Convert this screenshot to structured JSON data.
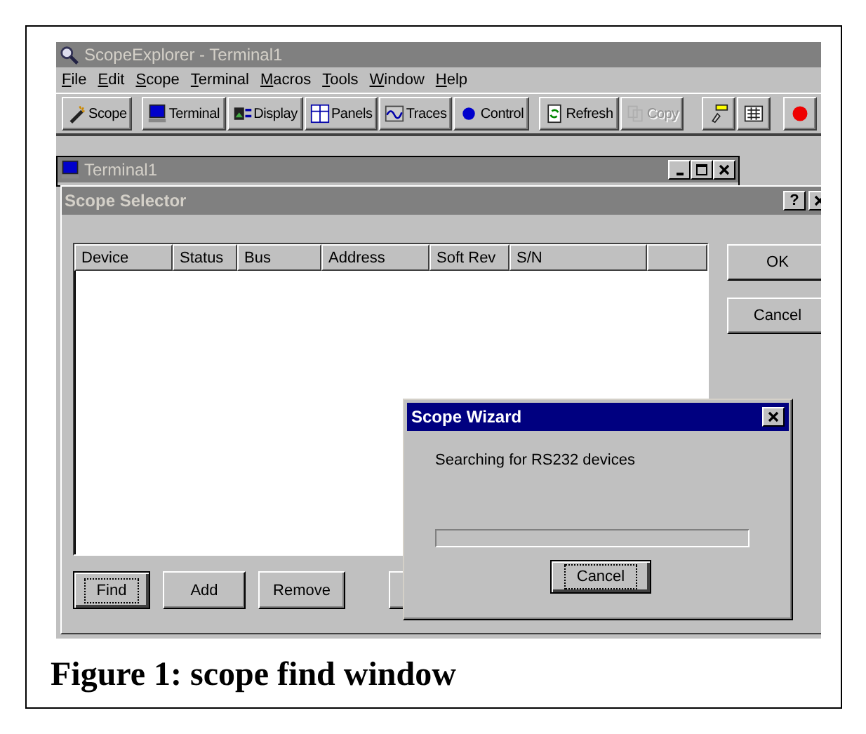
{
  "window": {
    "title": "ScopeExplorer - Terminal1"
  },
  "menu": [
    "File",
    "Edit",
    "Scope",
    "Terminal",
    "Macros",
    "Tools",
    "Window",
    "Help"
  ],
  "toolbar": [
    {
      "kind": "text",
      "label": "Scope",
      "disabled": false
    },
    {
      "kind": "text",
      "label": "Terminal",
      "disabled": false
    },
    {
      "kind": "text",
      "label": "Display",
      "disabled": false
    },
    {
      "kind": "text",
      "label": "Panels",
      "disabled": false
    },
    {
      "kind": "text",
      "label": "Traces",
      "disabled": false
    },
    {
      "kind": "text",
      "label": "Control",
      "disabled": false
    },
    {
      "kind": "text",
      "label": "Refresh",
      "disabled": false
    },
    {
      "kind": "text",
      "label": "Copy",
      "disabled": true
    },
    {
      "kind": "icon",
      "disabled": false
    },
    {
      "kind": "icon",
      "disabled": false
    },
    {
      "kind": "icon",
      "disabled": false
    }
  ],
  "child_window": {
    "title": "Terminal1"
  },
  "dialog": {
    "title": "Scope Selector",
    "help": "?",
    "columns": [
      "Device",
      "Status",
      "Bus",
      "Address",
      "Soft Rev",
      "S/N"
    ],
    "side_buttons": [
      "OK",
      "Cancel"
    ],
    "bottom_buttons": [
      {
        "label": "Find",
        "focused": true
      },
      {
        "label": "Add",
        "focused": false
      },
      {
        "label": "Remove",
        "focused": false
      }
    ]
  },
  "wizard": {
    "title": "Scope Wizard",
    "message": "Searching for RS232 devices",
    "button": {
      "label": "Cancel",
      "focused": true
    }
  },
  "caption": "Figure 1: scope find window"
}
